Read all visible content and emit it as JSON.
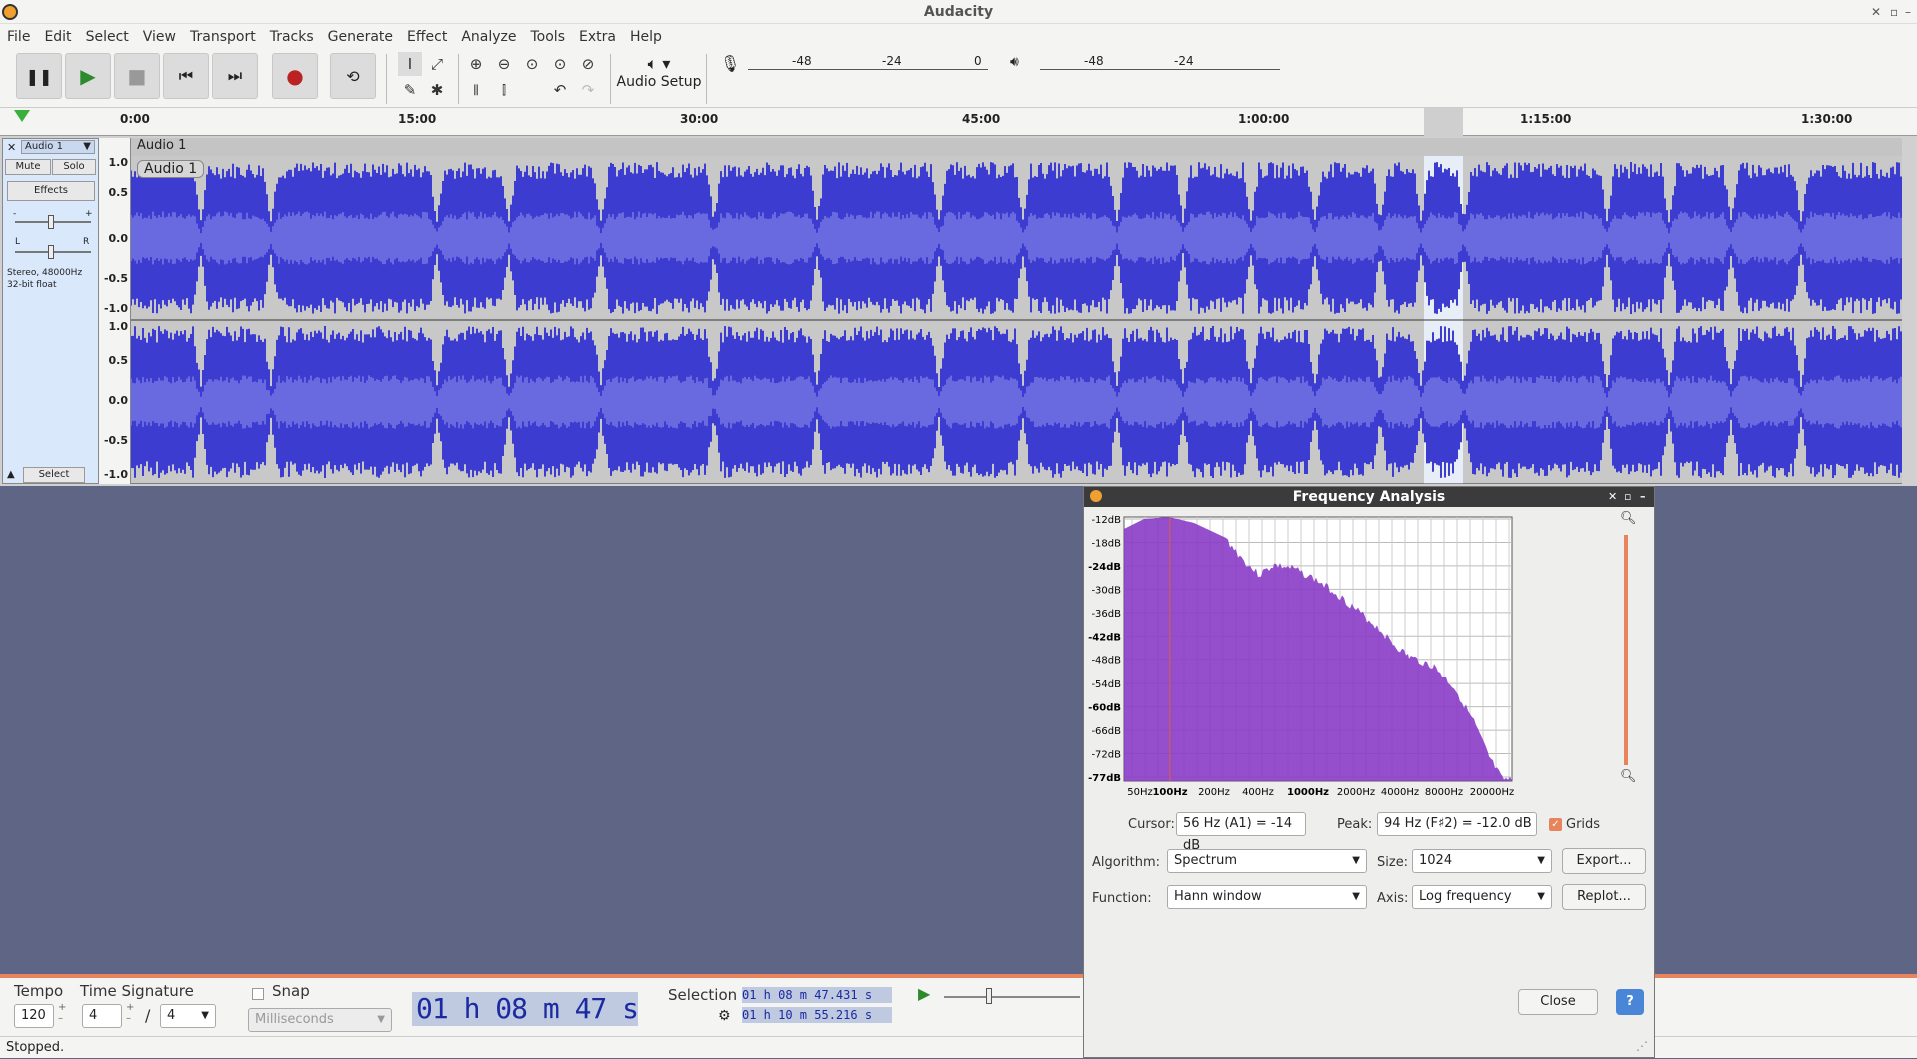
{
  "window": {
    "title": "Audacity"
  },
  "menu": [
    "File",
    "Edit",
    "Select",
    "View",
    "Transport",
    "Tracks",
    "Generate",
    "Effect",
    "Analyze",
    "Tools",
    "Extra",
    "Help"
  ],
  "toolbar": {
    "audio_setup": "Audio Setup",
    "meter_rec_ticks": [
      "-48",
      "-24",
      "0"
    ],
    "meter_play_ticks": [
      "-48",
      "-24"
    ],
    "meter_lr": "L R"
  },
  "ruler": {
    "labels": [
      "0:00",
      "15:00",
      "30:00",
      "45:00",
      "1:00:00",
      "1:15:00",
      "1:30:00"
    ]
  },
  "track": {
    "name": "Audio 1",
    "clip_name": "Audio 1",
    "mute": "Mute",
    "solo": "Solo",
    "effects": "Effects",
    "info": "Stereo, 48000Hz\n32-bit float",
    "select": "Select",
    "scale": [
      "1.0",
      "0.5",
      "0.0",
      "-0.5",
      "-1.0"
    ],
    "pan_l": "L",
    "pan_r": "R",
    "gain_minus": "-",
    "gain_plus": "+"
  },
  "dialog": {
    "title": "Frequency Analysis",
    "y_ticks": [
      "-12dB",
      "-18dB",
      "-24dB",
      "-30dB",
      "-36dB",
      "-42dB",
      "-48dB",
      "-54dB",
      "-60dB",
      "-66dB",
      "-72dB",
      "-77dB"
    ],
    "x_ticks": [
      "50Hz",
      "100Hz",
      "200Hz",
      "400Hz",
      "1000Hz",
      "2000Hz",
      "4000Hz",
      "8000Hz",
      "20000Hz"
    ],
    "cursor_label": "Cursor:",
    "cursor_value": "56 Hz (A1) = -14 dB",
    "peak_label": "Peak:",
    "peak_value": "94 Hz (F♯2) = -12.0 dB",
    "grids_label": "Grids",
    "algorithm_label": "Algorithm:",
    "algorithm_value": "Spectrum",
    "size_label": "Size:",
    "size_value": "1024",
    "function_label": "Function:",
    "function_value": "Hann window",
    "axis_label": "Axis:",
    "axis_value": "Log frequency",
    "export": "Export...",
    "replot": "Replot...",
    "close": "Close",
    "help": "?"
  },
  "bottom": {
    "tempo_label": "Tempo",
    "tempo_value": "120",
    "timesig_label": "Time Signature",
    "timesig_num": "4",
    "timesig_sep": "/",
    "timesig_den": "4",
    "snap_label": "Snap",
    "snap_unit": "Milliseconds",
    "time_display": "01 h 08 m 47 s",
    "selection_label": "Selection",
    "sel_start": "01 h 08 m 47.431 s",
    "sel_end": "01 h 10 m 55.216 s"
  },
  "status": "Stopped.",
  "colors": {
    "wave": "#3c3cd0",
    "wave_rms": "#6a6ae0",
    "spectrum": "#8a3cc6",
    "accent": "#e8845c"
  }
}
